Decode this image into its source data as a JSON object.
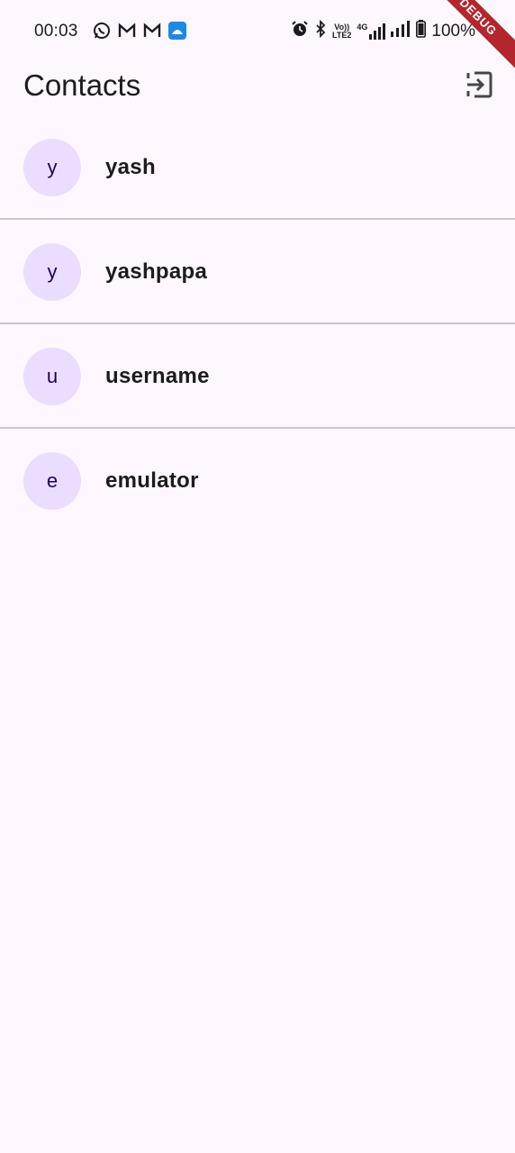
{
  "status_bar": {
    "time": "00:03",
    "left_icons": [
      "whatsapp-icon",
      "gmail-icon",
      "gmail-icon",
      "app-notification-icon"
    ],
    "right_icons": [
      "alarm-icon",
      "bluetooth-icon",
      "volte-icon",
      "4g-signal-icon",
      "signal-icon",
      "battery-icon"
    ],
    "volte_label_top": "Vo))",
    "volte_label_bottom": "LTE2",
    "network_label": "4G",
    "battery": "100%"
  },
  "debug_banner": "DEBUG",
  "app_bar": {
    "title": "Contacts",
    "action_icon": "logout-icon"
  },
  "contacts": [
    {
      "initial": "y",
      "name": "yash"
    },
    {
      "initial": "y",
      "name": "yashpapa"
    },
    {
      "initial": "u",
      "name": "username"
    },
    {
      "initial": "e",
      "name": "emulator"
    }
  ],
  "colors": {
    "background": "#FEF7FF",
    "avatar_bg": "#EADDFF",
    "avatar_text": "#21005D",
    "divider": "#CAC4D0",
    "debug_banner": "#B3262D"
  }
}
